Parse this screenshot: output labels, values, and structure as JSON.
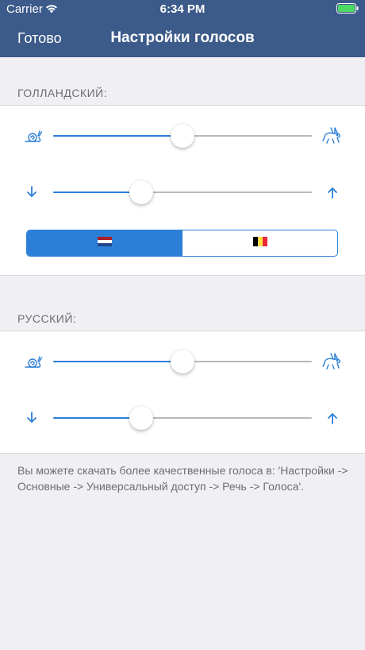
{
  "status_bar": {
    "carrier": "Carrier",
    "time": "6:34 PM"
  },
  "nav": {
    "done_label": "Готово",
    "title": "Настройки голосов"
  },
  "sections": [
    {
      "header": "ГОЛЛАНДСКИЙ:",
      "speed_slider": {
        "value": 0.5,
        "min_icon": "snail-icon",
        "max_icon": "rabbit-icon"
      },
      "pitch_slider": {
        "value": 0.34,
        "min_icon": "arrow-down-icon",
        "max_icon": "arrow-up-icon"
      },
      "accent_segments": [
        {
          "icon": "netherlands-flag-icon",
          "selected": true
        },
        {
          "icon": "belgium-flag-icon",
          "selected": false
        }
      ]
    },
    {
      "header": "РУССКИЙ:",
      "speed_slider": {
        "value": 0.5,
        "min_icon": "snail-icon",
        "max_icon": "rabbit-icon"
      },
      "pitch_slider": {
        "value": 0.34,
        "min_icon": "arrow-down-icon",
        "max_icon": "arrow-up-icon"
      }
    }
  ],
  "footer": "Вы можете скачать более качественные голоса в: 'Настройки -> Основные -> Универсальный доступ -> Речь -> Голоса'.",
  "colors": {
    "nav_bg": "#3c5a8a",
    "accent": "#2c7fd6",
    "battery": "#4cd964"
  }
}
